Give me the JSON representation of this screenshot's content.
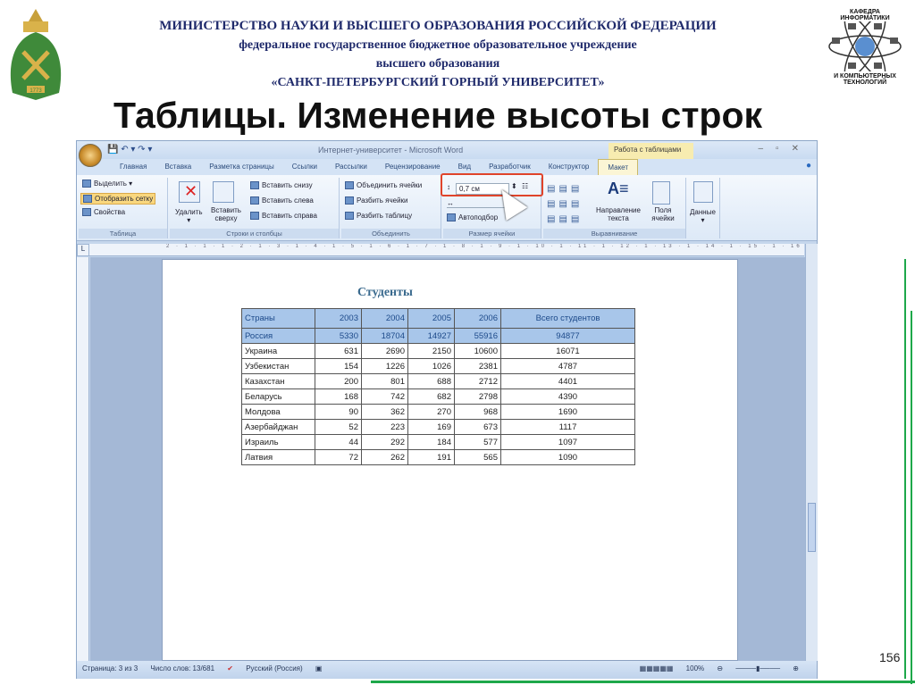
{
  "header": {
    "line1": "МИНИСТЕРСТВО НАУКИ И ВЫСШЕГО ОБРАЗОВАНИЯ РОССИЙСКОЙ ФЕДЕРАЦИИ",
    "line2": "федеральное государственное бюджетное образовательное учреждение",
    "line3": "высшего образования",
    "line4": "«САНКТ-ПЕТЕРБУРГСКИЙ ГОРНЫЙ УНИВЕРСИТЕТ»"
  },
  "slide_title": "Таблицы. Изменение высоты строк",
  "logo_right": {
    "top": "КАФЕДРА ИНФОРМАТИКИ",
    "bottom": "И КОМПЬЮТЕРНЫХ ТЕХНОЛОГИЙ"
  },
  "logo_left": {
    "year": "1773"
  },
  "word": {
    "title": "Интернет-университет - Microsoft Word",
    "context_tab": "Работа с таблицами",
    "tabs": [
      "Главная",
      "Вставка",
      "Разметка страницы",
      "Ссылки",
      "Рассылки",
      "Рецензирование",
      "Вид",
      "Разработчик",
      "Конструктор",
      "Макет"
    ],
    "ribbon": {
      "table": {
        "label": "Таблица",
        "select": "Выделить ▾",
        "show_grid": "Отобразить сетку",
        "properties": "Свойства"
      },
      "rows_cols": {
        "label": "Строки и столбцы",
        "delete": "Удалить",
        "insert_above": "Вставить сверху",
        "insert_below": "Вставить снизу",
        "insert_left": "Вставить слева",
        "insert_right": "Вставить справа"
      },
      "merge": {
        "label": "Объединить",
        "merge_cells": "Объединить ячейки",
        "split_cells": "Разбить ячейки",
        "split_table": "Разбить таблицу"
      },
      "cell_size": {
        "label": "Размер ячейки",
        "height_value": "0,7 см",
        "autofit": "Автоподбор"
      },
      "alignment": {
        "label": "Выравнивание",
        "text_direction": "Направление текста",
        "cell_margins": "Поля ячейки"
      },
      "data": {
        "label": "Данные"
      }
    },
    "ruler": "2 · 1 · 1 · 1 · 2 · 1 · 3 · 1 · 4 · 1 · 5 · 1 · 6 · 1 · 7 · 1 · 8 · 1 · 9 · 1 · 10 · 1 · 11 · 1 · 12 · 1 · 13 · 1 · 14 · 1 · 15 · 1 · 16",
    "status": {
      "page": "Страница: 3 из 3",
      "words": "Число слов: 13/681",
      "language": "Русский (Россия)",
      "zoom": "100%"
    }
  },
  "document": {
    "table_title": "Студенты",
    "columns": [
      "Страны",
      "2003",
      "2004",
      "2005",
      "2006",
      "Всего студентов"
    ],
    "rows": [
      [
        "Россия",
        "5330",
        "18704",
        "14927",
        "55916",
        "94877"
      ],
      [
        "Украина",
        "631",
        "2690",
        "2150",
        "10600",
        "16071"
      ],
      [
        "Узбекистан",
        "154",
        "1226",
        "1026",
        "2381",
        "4787"
      ],
      [
        "Казахстан",
        "200",
        "801",
        "688",
        "2712",
        "4401"
      ],
      [
        "Беларусь",
        "168",
        "742",
        "682",
        "2798",
        "4390"
      ],
      [
        "Молдова",
        "90",
        "362",
        "270",
        "968",
        "1690"
      ],
      [
        "Азербайджан",
        "52",
        "223",
        "169",
        "673",
        "1117"
      ],
      [
        "Израиль",
        "44",
        "292",
        "184",
        "577",
        "1097"
      ],
      [
        "Латвия",
        "72",
        "262",
        "191",
        "565",
        "1090"
      ]
    ]
  },
  "page_number": "156",
  "colors": {
    "accent_green": "#1ea84a",
    "highlight_red": "#e0442a",
    "header_blue": "#1f2a6b"
  }
}
